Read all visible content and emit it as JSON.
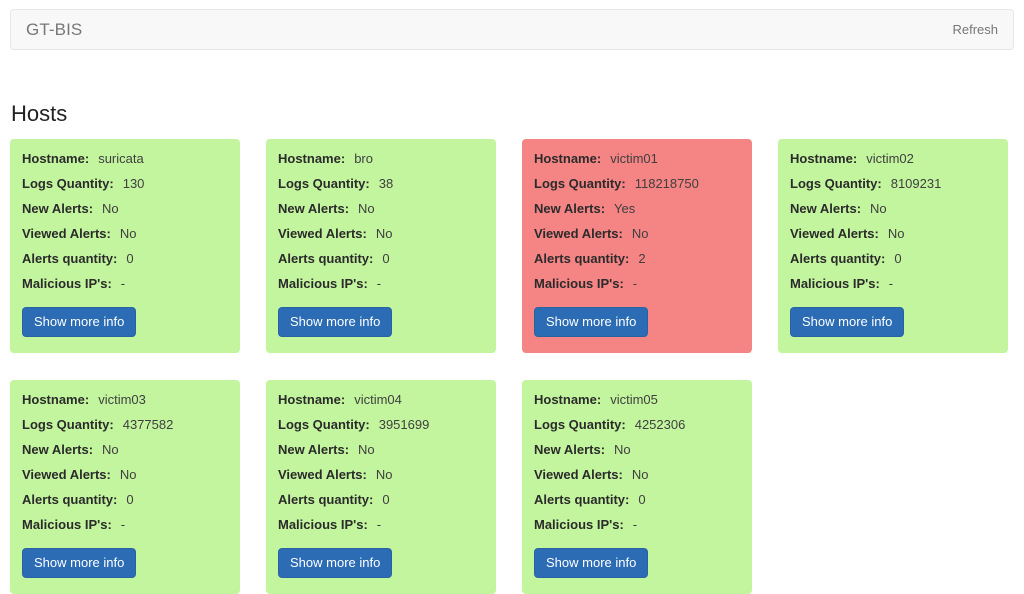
{
  "navbar": {
    "brand": "GT-BIS",
    "refresh_label": "Refresh"
  },
  "page": {
    "title": "Hosts"
  },
  "card_labels": {
    "hostname": "Hostname:",
    "logs_quantity": "Logs Quantity:",
    "new_alerts": "New Alerts:",
    "viewed_alerts": "Viewed Alerts:",
    "alerts_quantity": "Alerts quantity:",
    "malicious_ips": "Malicious IP's:",
    "show_more": "Show more info"
  },
  "colors": {
    "card_ok": "#c3f59f",
    "card_alert": "#f58484",
    "button": "#2b6cb5",
    "navbar_bg": "#f8f8f8",
    "navbar_border": "#e7e7e7",
    "muted_text": "#777777"
  },
  "hosts": [
    {
      "hostname": "suricata",
      "logs_quantity": "130",
      "new_alerts": "No",
      "viewed_alerts": "No",
      "alerts_quantity": "0",
      "malicious_ips": "-",
      "status": "ok"
    },
    {
      "hostname": "bro",
      "logs_quantity": "38",
      "new_alerts": "No",
      "viewed_alerts": "No",
      "alerts_quantity": "0",
      "malicious_ips": "-",
      "status": "ok"
    },
    {
      "hostname": "victim01",
      "logs_quantity": "118218750",
      "new_alerts": "Yes",
      "viewed_alerts": "No",
      "alerts_quantity": "2",
      "malicious_ips": "-",
      "status": "alert"
    },
    {
      "hostname": "victim02",
      "logs_quantity": "8109231",
      "new_alerts": "No",
      "viewed_alerts": "No",
      "alerts_quantity": "0",
      "malicious_ips": "-",
      "status": "ok"
    },
    {
      "hostname": "victim03",
      "logs_quantity": "4377582",
      "new_alerts": "No",
      "viewed_alerts": "No",
      "alerts_quantity": "0",
      "malicious_ips": "-",
      "status": "ok"
    },
    {
      "hostname": "victim04",
      "logs_quantity": "3951699",
      "new_alerts": "No",
      "viewed_alerts": "No",
      "alerts_quantity": "0",
      "malicious_ips": "-",
      "status": "ok"
    },
    {
      "hostname": "victim05",
      "logs_quantity": "4252306",
      "new_alerts": "No",
      "viewed_alerts": "No",
      "alerts_quantity": "0",
      "malicious_ips": "-",
      "status": "ok"
    }
  ]
}
